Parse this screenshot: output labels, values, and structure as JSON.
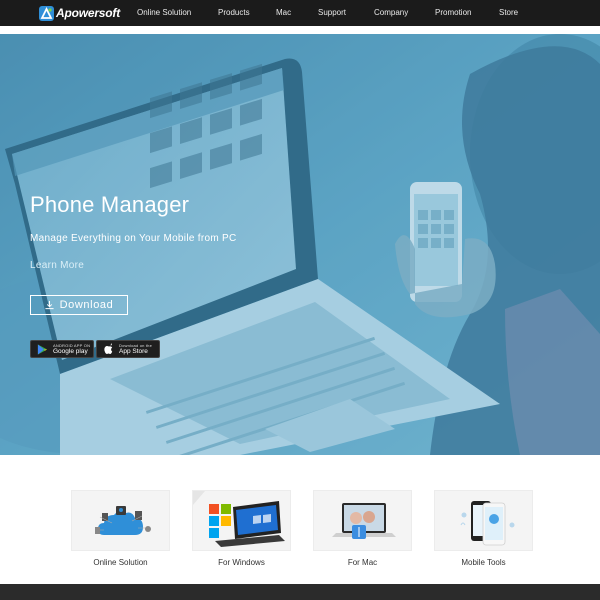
{
  "brand": {
    "name": "Apowersoft"
  },
  "nav": {
    "items": [
      {
        "label": "Online Solution"
      },
      {
        "label": "Products"
      },
      {
        "label": "Mac"
      },
      {
        "label": "Support"
      },
      {
        "label": "Company"
      },
      {
        "label": "Promotion"
      },
      {
        "label": "Store"
      }
    ]
  },
  "hero": {
    "title": "Phone Manager",
    "subtitle": "Manage Everything on Your Mobile from PC",
    "learn_more": "Learn More",
    "download_label": "Download",
    "badges": {
      "google_small": "ANDROID APP ON",
      "google_big": "Google play",
      "apple_small": "Download on the",
      "apple_big": "App Store"
    }
  },
  "categories": [
    {
      "label": "Online Solution",
      "icon": "cloud-icon"
    },
    {
      "label": "For Windows",
      "icon": "windows-tablet-icon"
    },
    {
      "label": "For Mac",
      "icon": "mac-laptop-icon"
    },
    {
      "label": "Mobile Tools",
      "icon": "phones-icon"
    }
  ],
  "colors": {
    "nav_bg": "#1b1b1b",
    "hero_tint": "#5aa0be",
    "footer_bg": "#2b2b2b",
    "accent_blue": "#2f8fd8"
  }
}
